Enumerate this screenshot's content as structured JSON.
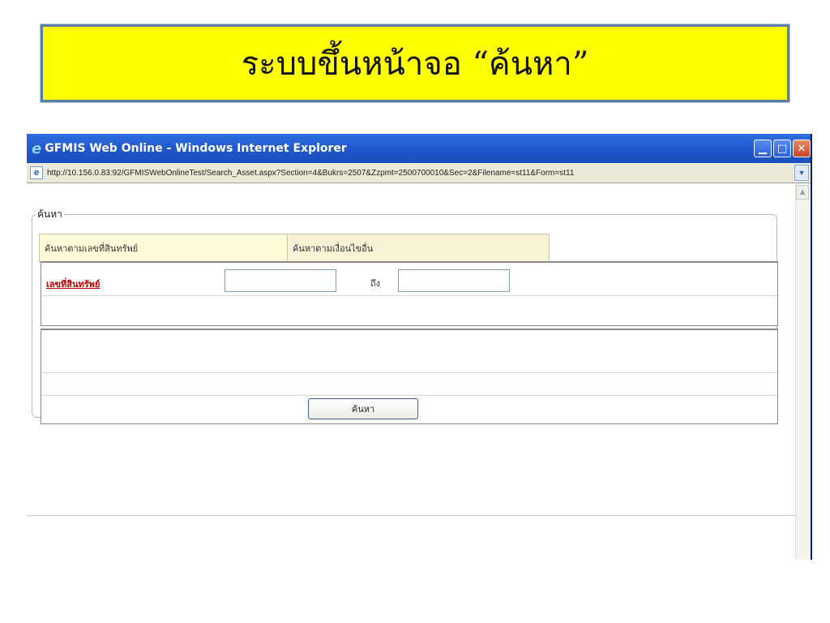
{
  "slide": {
    "title": "ระบบขึ้นหน้าจอ “ค้นหา”"
  },
  "window": {
    "title": "GFMIS Web Online - Windows Internet Explorer",
    "url": "http://10.156.0.83:92/GFMISWebOnlineTest/Search_Asset.aspx?Section=4&Bukrs=2507&Zzpmt=2500700010&Sec=2&Filename=st11&Form=st11",
    "buttons": {
      "minimize": "▁",
      "maximize": "□",
      "close": "✕"
    }
  },
  "search_form": {
    "legend": "ค้นหา",
    "tabs": [
      {
        "label": "ค้นหาตามเลขที่สินทรัพย์"
      },
      {
        "label": "ค้นหาตามเงื่อนไขอื่น"
      }
    ],
    "asset_number_label": "เลขที่สินทรัพย์",
    "asset_from_value": "",
    "to_label": "ถึง",
    "asset_to_value": "",
    "search_button_label": "ค้นหา"
  },
  "colors": {
    "banner_bg": "#ffff00",
    "titlebar": "#1f56c9",
    "required_label": "#c00000"
  }
}
